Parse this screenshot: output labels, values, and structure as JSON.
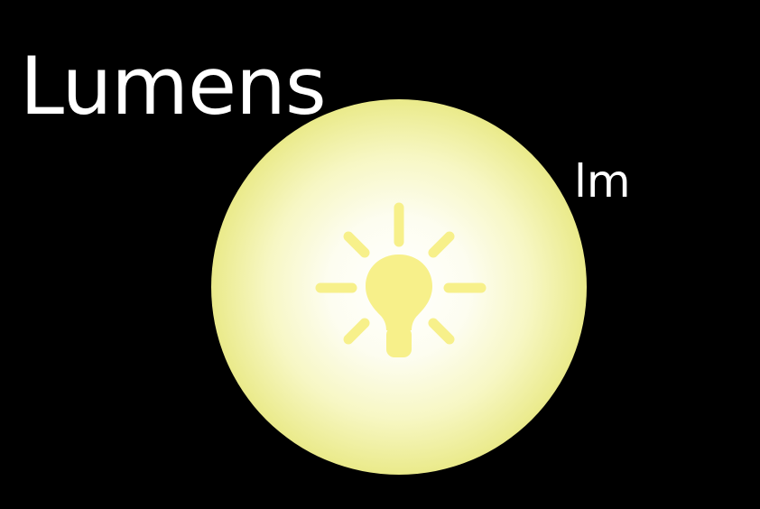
{
  "title": "Lumens",
  "unit": "lm",
  "icon": "lightbulb-icon",
  "colors": {
    "background": "#000000",
    "text": "#ffffff",
    "glow_center": "#ffffff",
    "glow_mid": "#fbfbc8",
    "glow_edge": "#ecec8c",
    "bulb": "#f7f08a"
  }
}
